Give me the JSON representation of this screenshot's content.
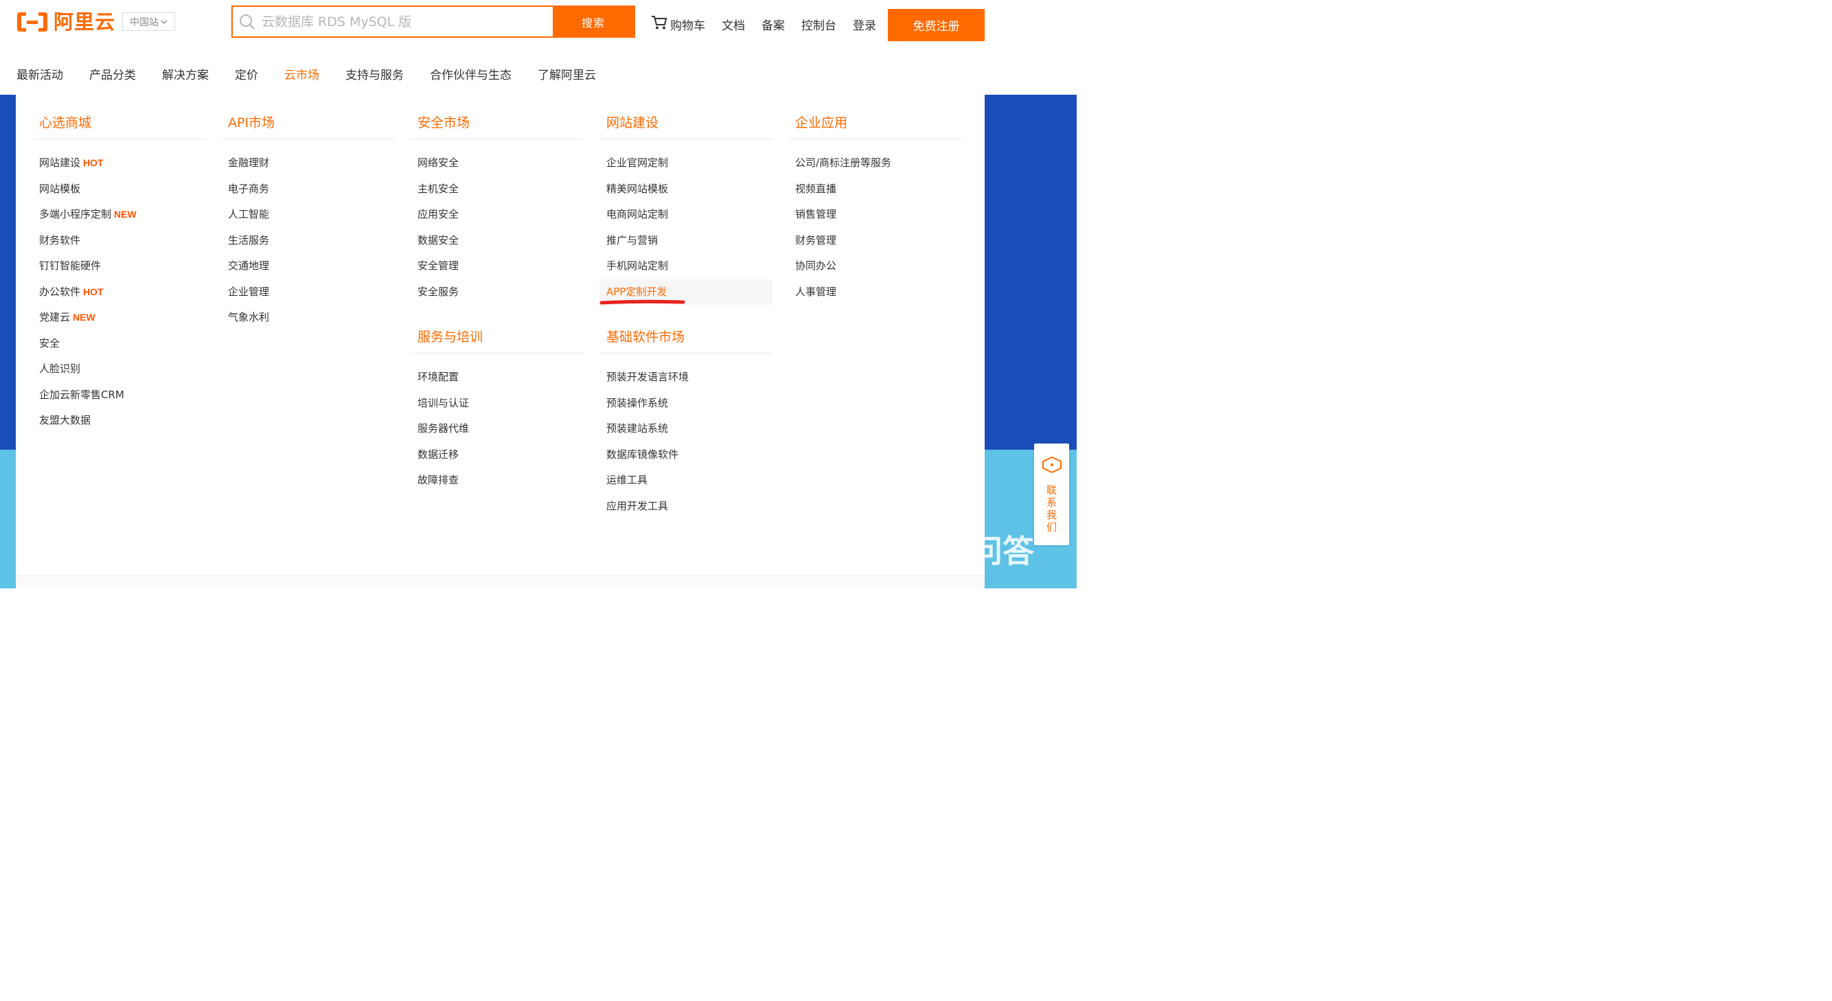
{
  "colors": {
    "accent": "#ff6a00",
    "banner_dark": "#1b4db8",
    "banner_light": "#5ec2e6",
    "tag": "#ff5500"
  },
  "header": {
    "logo_text": "阿里云",
    "region": "中国站",
    "search": {
      "placeholder": "云数据库 RDS MySQL 版",
      "button": "搜索"
    },
    "links": {
      "cart": "购物车",
      "docs": "文档",
      "filing": "备案",
      "console": "控制台",
      "login": "登录"
    },
    "register": "免费注册"
  },
  "nav": [
    {
      "label": "最新活动"
    },
    {
      "label": "产品分类"
    },
    {
      "label": "解决方案"
    },
    {
      "label": "定价"
    },
    {
      "label": "云市场",
      "active": true
    },
    {
      "label": "支持与服务"
    },
    {
      "label": "合作伙伴与生态"
    },
    {
      "label": "了解阿里云"
    }
  ],
  "menu": {
    "col1": {
      "title": "心选商城",
      "items": [
        {
          "label": "网站建设",
          "tag": "HOT"
        },
        {
          "label": "网站模板"
        },
        {
          "label": "多端小程序定制",
          "tag": "NEW"
        },
        {
          "label": "财务软件"
        },
        {
          "label": "钉钉智能硬件"
        },
        {
          "label": "办公软件",
          "tag": "HOT"
        },
        {
          "label": "党建云",
          "tag": "NEW"
        },
        {
          "label": "安全"
        },
        {
          "label": "人脸识别"
        },
        {
          "label": "企加云新零售CRM"
        },
        {
          "label": "友盟大数据"
        }
      ]
    },
    "col2": {
      "title": "API市场",
      "items": [
        "金融理财",
        "电子商务",
        "人工智能",
        "生活服务",
        "交通地理",
        "企业管理",
        "气象水利"
      ]
    },
    "col3": {
      "title": "安全市场",
      "items": [
        "网络安全",
        "主机安全",
        "应用安全",
        "数据安全",
        "安全管理",
        "安全服务"
      ],
      "title2": "服务与培训",
      "items2": [
        "环境配置",
        "培训与认证",
        "服务器代维",
        "数据迁移",
        "故障排查"
      ]
    },
    "col4": {
      "title": "网站建设",
      "items": [
        "企业官网定制",
        "精美网站模板",
        "电商网站定制",
        "推广与营销",
        "手机网站定制",
        "APP定制开发"
      ],
      "title2": "基础软件市场",
      "items2": [
        "预装开发语言环境",
        "预装操作系统",
        "预装建站系统",
        "数据库镜像软件",
        "运维工具",
        "应用开发工具"
      ]
    },
    "col5": {
      "title": "企业应用",
      "items": [
        "公司/商标注册等服务",
        "视频直播",
        "销售管理",
        "财务管理",
        "协同办公",
        "人事管理"
      ]
    }
  },
  "contact": "联系我们",
  "watermark": "悟空问答"
}
